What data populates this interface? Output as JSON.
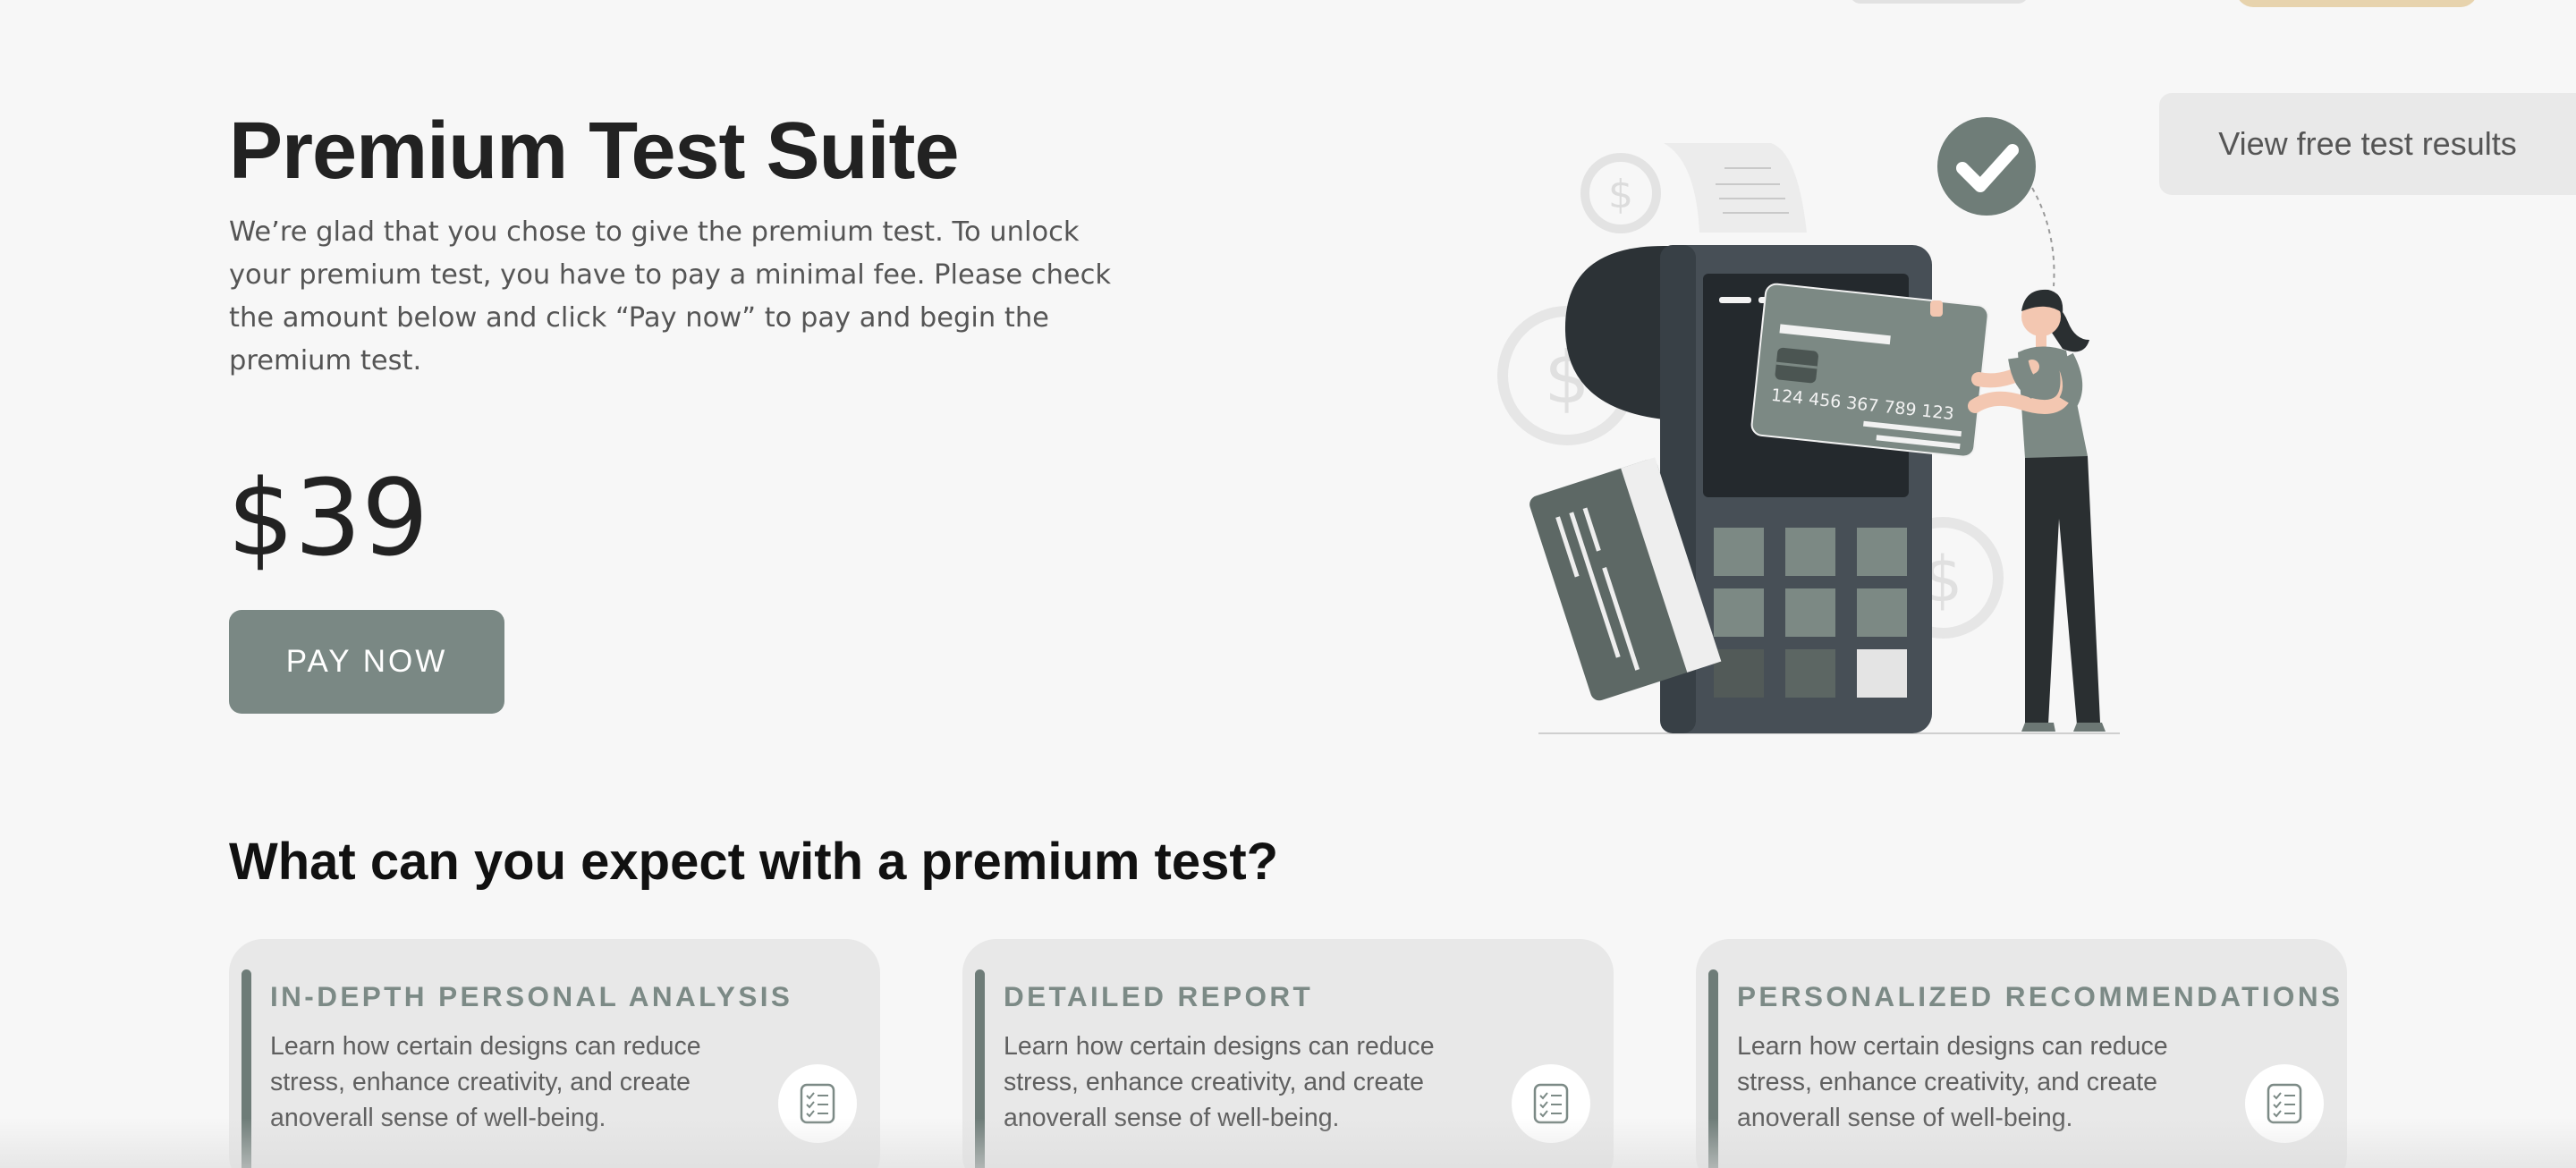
{
  "header": {
    "view_free_label": "View free test results"
  },
  "hero": {
    "title": "Premium Test Suite",
    "intro": "We’re glad that you chose to give the premium test. To unlock your premium test, you have to pay a minimal fee. Please check the amount below and click “Pay now” to pay and begin the premium test.",
    "price": "$39",
    "pay_label": "PAY NOW"
  },
  "illustration": {
    "card_number": "124 456 367 789 123"
  },
  "features": {
    "title": "What can you expect with a premium test?",
    "items": [
      {
        "title": "IN-DEPTH PERSONAL ANALYSIS",
        "description": "Learn how certain designs can reduce stress, enhance creativity, and create anoverall sense of well-being.",
        "icon": "checklist-icon"
      },
      {
        "title": "DETAILED REPORT",
        "description": "Learn how certain designs can reduce stress, enhance creativity, and create anoverall sense of well-being.",
        "icon": "checklist-icon"
      },
      {
        "title": "PERSONALIZED RECOMMENDATIONS",
        "description": "Learn how certain designs can reduce stress, enhance creativity, and create anoverall sense of well-being.",
        "icon": "checklist-icon"
      }
    ]
  },
  "colors": {
    "background": "#f7f7f7",
    "accent": "#7a8884",
    "card_bg": "#e8e8e8",
    "card_title": "#7c8a86"
  }
}
